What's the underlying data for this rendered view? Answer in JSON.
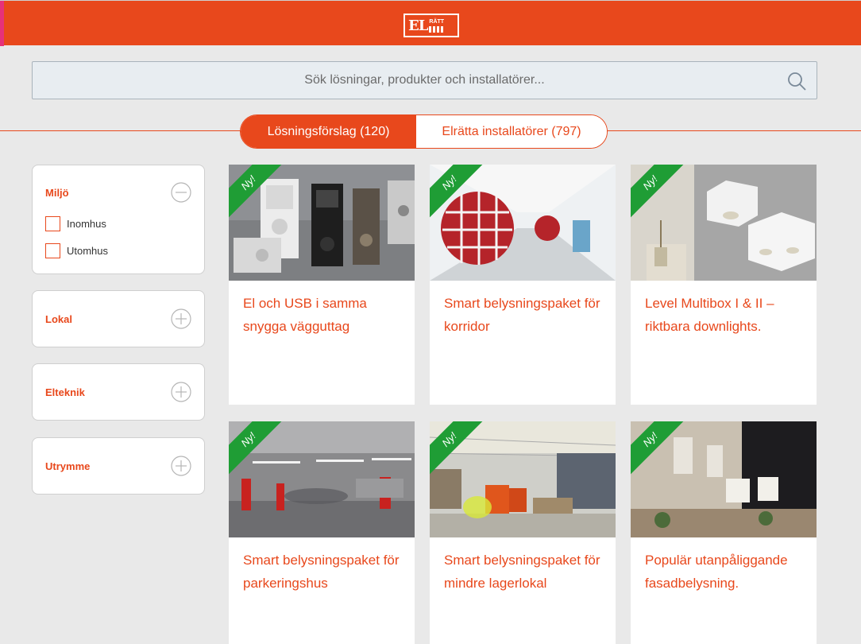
{
  "header": {
    "logo_main": "EL",
    "logo_sub": "RÄTT"
  },
  "search": {
    "placeholder": "Sök lösningar, produkter och installatörer..."
  },
  "tabs": [
    {
      "label": "Lösningsförslag (120)",
      "active": true
    },
    {
      "label": "Elrätta installatörer (797)",
      "active": false
    }
  ],
  "filters": [
    {
      "title": "Miljö",
      "expanded": true,
      "options": [
        "Inomhus",
        "Utomhus"
      ]
    },
    {
      "title": "Lokal",
      "expanded": false
    },
    {
      "title": "Elteknik",
      "expanded": false
    },
    {
      "title": "Utrymme",
      "expanded": false
    }
  ],
  "badge_label": "Ny!",
  "cards": [
    {
      "title": "El och USB i samma snygga vägguttag"
    },
    {
      "title": "Smart belysningspaket för korridor"
    },
    {
      "title": "Level Multibox I & II – riktbara downlights."
    },
    {
      "title": "Smart belysningspaket för parkeringshus"
    },
    {
      "title": "Smart belysningspaket för mindre lagerlokal"
    },
    {
      "title": "Populär utanpåliggande fasadbelysning."
    }
  ],
  "colors": {
    "brand": "#e8481c",
    "badge": "#1f9d35",
    "background": "#e9e9e9"
  }
}
